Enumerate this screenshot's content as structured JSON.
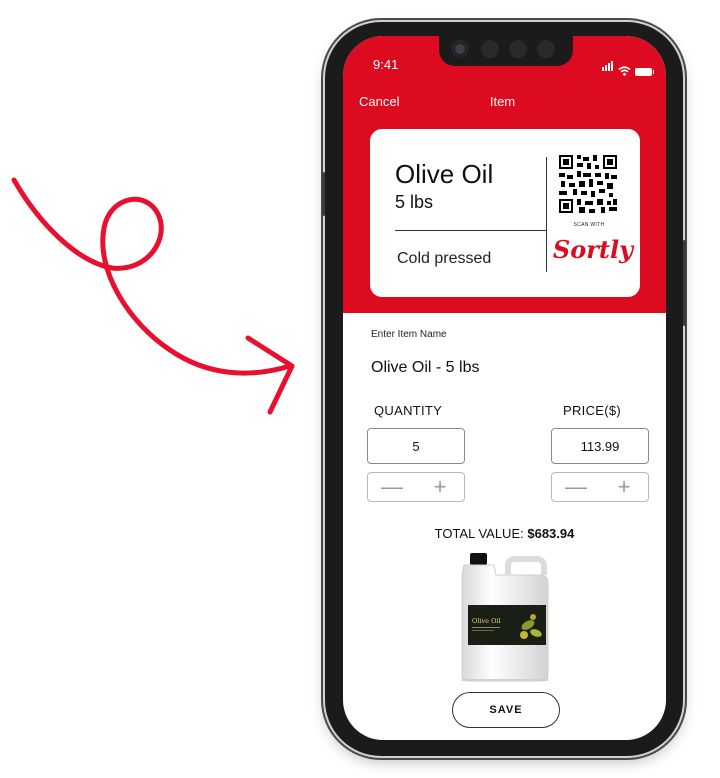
{
  "status_bar": {
    "time": "9:41"
  },
  "nav": {
    "cancel_label": "Cancel",
    "title": "Item"
  },
  "label_card": {
    "name": "Olive Oil",
    "size": "5 lbs",
    "description": "Cold pressed",
    "scan_with": "SCAN WITH",
    "brand": "Sortly"
  },
  "form": {
    "name_label": "Enter Item Name",
    "name_value": "Olive Oil - 5 lbs",
    "quantity_label": "QUANTITY",
    "quantity_value": "5",
    "price_label": "PRICE($)",
    "price_value": "113.99",
    "decrement_symbol": "—",
    "increment_symbol": "+",
    "total_label": "TOTAL VALUE:",
    "total_value": "$683.94"
  },
  "product_image": {
    "label_title": "Olive Oil"
  },
  "save_label": "SAVE",
  "colors": {
    "accent": "#dc0b1f",
    "arrow": "#e8102e"
  }
}
